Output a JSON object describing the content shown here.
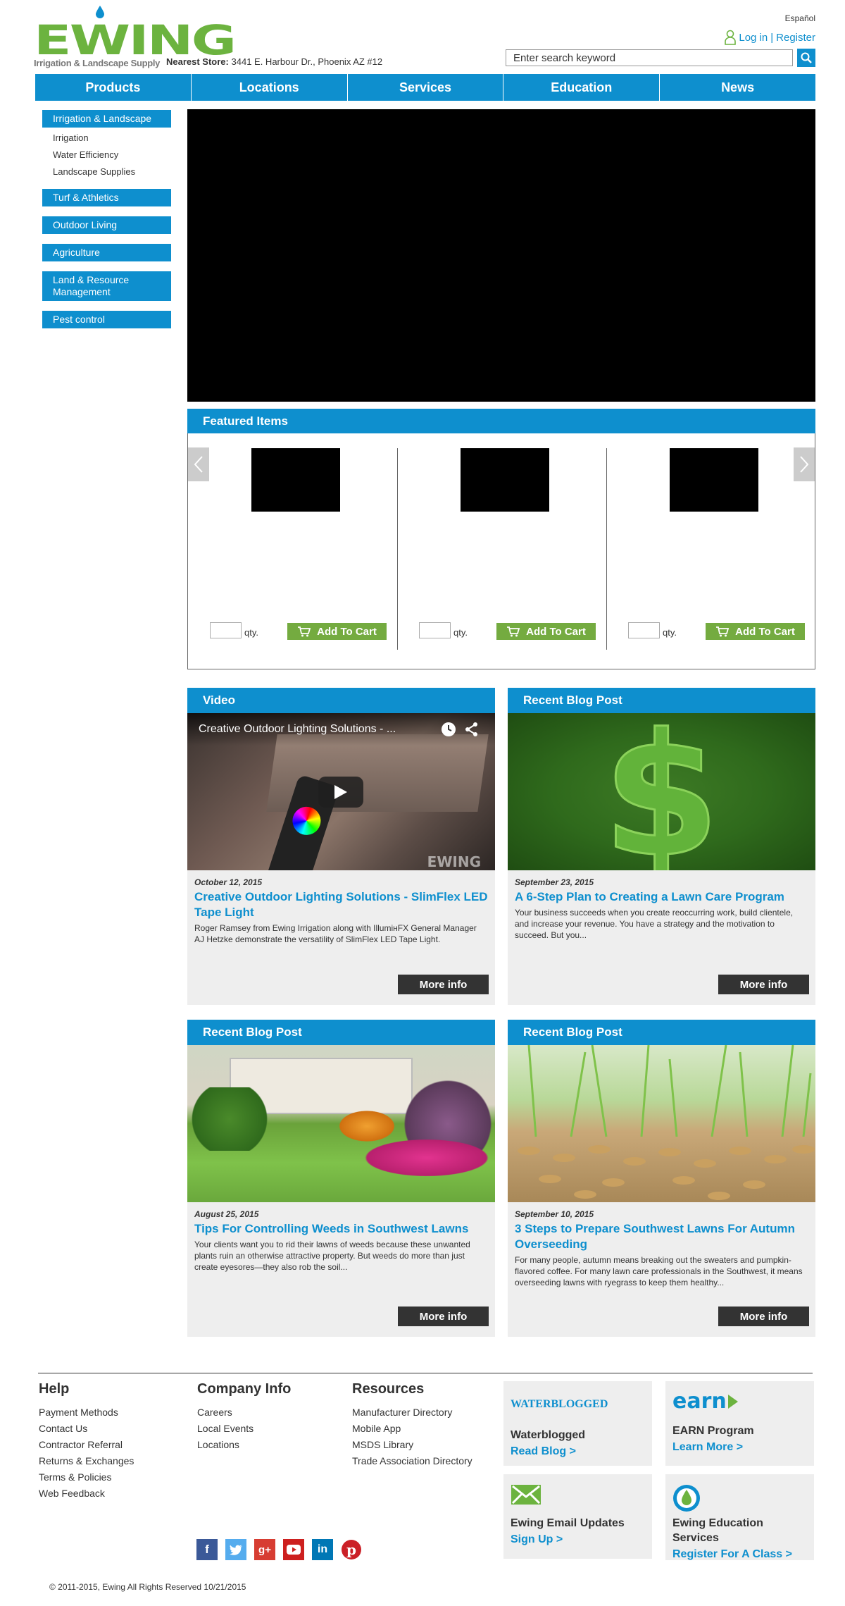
{
  "header": {
    "logo_text": "EWING",
    "logo_subtitle": "Irrigation & Landscape Supply",
    "nearest_store_label": "Nearest Store:",
    "nearest_store_value": "3441 E. Harbour Dr., Phoenix AZ #12",
    "language_link": "Español",
    "login_label": "Log in",
    "separator": "|",
    "register_label": "Register",
    "search_placeholder": "Enter search keyword"
  },
  "nav": [
    "Products",
    "Locations",
    "Services",
    "Education",
    "News"
  ],
  "sidebar": {
    "primary": "Irrigation & Landscape",
    "subitems": [
      "Irrigation",
      "Water Efficiency",
      "Landscape Supplies"
    ],
    "categories": [
      "Turf & Athletics",
      "Outdoor Living",
      "Agriculture",
      "Land & Resource Management",
      "Pest control"
    ]
  },
  "featured": {
    "title": "Featured Items",
    "qty_label": "qty.",
    "cart_label": "Add To Cart"
  },
  "cards": [
    {
      "header": "Video",
      "overlay_title": "Creative Outdoor Lighting Solutions - ...",
      "date": "October 12, 2015",
      "title": "Creative Outdoor Lighting Solutions - SlimFlex LED Tape Light",
      "text": "Roger Ramsey from Ewing Irrigation along with IllumінFX General Manager AJ Hetzke demonstrate the versatility of SlimFlex LED Tape Light.",
      "button": "More info",
      "watermark": "EWING"
    },
    {
      "header": "Recent Blog Post",
      "date": "September 23, 2015",
      "title": "A 6-Step Plan to Creating a Lawn Care Program",
      "text": "Your business succeeds when you create reoccurring work, build clientele, and increase your revenue. You have a strategy and the motivation to succeed. But you...",
      "button": "More info"
    },
    {
      "header": "Recent Blog Post",
      "date": "August 25, 2015",
      "title": "Tips For Controlling Weeds in Southwest Lawns",
      "text": "Your clients want you to rid their lawns of weeds because these unwanted plants ruin an otherwise attractive property. But weeds do more than just create eyesores—they also rob the soil...",
      "button": "More info"
    },
    {
      "header": "Recent Blog Post",
      "date": "September 10, 2015",
      "title": "3 Steps to Prepare Southwest Lawns For Autumn Overseeding",
      "text": "For many people, autumn means breaking out the sweaters and pumpkin-flavored coffee. For many lawn care professionals in the Southwest, it means overseeding lawns with ryegrass to keep them healthy...",
      "button": "More info"
    }
  ],
  "footer": {
    "help": {
      "title": "Help",
      "links": [
        "Payment Methods",
        "Contact Us",
        "Contractor Referral",
        "Returns & Exchanges",
        "Terms & Policies",
        "Web Feedback"
      ]
    },
    "company": {
      "title": "Company Info",
      "links": [
        "Careers",
        "Local Events",
        "Locations"
      ]
    },
    "resources": {
      "title": "Resources",
      "links": [
        "Manufacturer Directory",
        "Mobile App",
        "MSDS Library",
        "Trade Association Directory"
      ]
    },
    "promos": [
      {
        "logo": "WATERBLOGGED",
        "title": "Waterblogged",
        "link": "Read Blog >"
      },
      {
        "logo": "earn",
        "title": "EARN Program",
        "link": "Learn More >"
      },
      {
        "title": "Ewing Email Updates",
        "link": "Sign Up >"
      },
      {
        "title": "Ewing Education Services",
        "link": "Register For A Class >"
      }
    ],
    "social": [
      "facebook-icon",
      "twitter-icon",
      "google-plus-icon",
      "youtube-icon",
      "linkedin-icon",
      "pinterest-icon"
    ],
    "copyright": "© 2011-2015, Ewing All Rights Reserved 10/21/2015"
  },
  "colors": {
    "brand_blue": "#0e8fce",
    "brand_green": "#6cb33f",
    "cart_green": "#74ab40",
    "dark_button": "#333333"
  }
}
